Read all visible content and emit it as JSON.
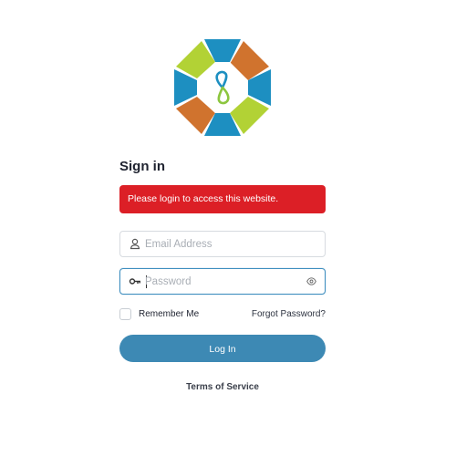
{
  "heading": "Sign in",
  "alert": {
    "message": "Please login to access this website."
  },
  "email": {
    "placeholder": "Email Address",
    "value": ""
  },
  "password": {
    "placeholder": "Password",
    "value": ""
  },
  "remember": {
    "label": "Remember Me",
    "checked": false
  },
  "forgot_label": "Forgot Password?",
  "login_label": "Log In",
  "terms_label": "Terms of Service",
  "icons": {
    "logo": "octagon-infinity-logo",
    "email": "person-icon",
    "password": "key-icon",
    "toggle": "eye-icon"
  },
  "colors": {
    "logo_blue": "#1d8fc1",
    "logo_green": "#b2d235",
    "logo_orange": "#d0732e",
    "alert": "#dc1f26",
    "button": "#3d89b4",
    "focus_border": "#3f8fbf"
  }
}
